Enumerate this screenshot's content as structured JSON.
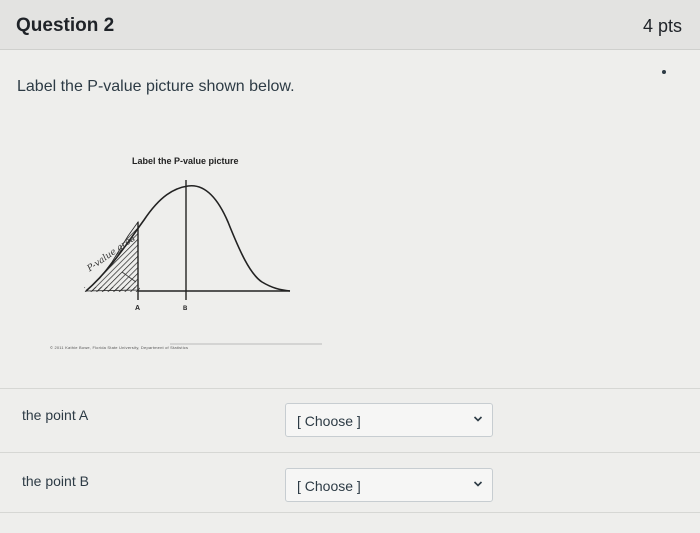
{
  "question": {
    "title": "Question 2",
    "points": "4 pts",
    "prompt": "Label the P-value picture shown below."
  },
  "figure": {
    "title": "Label the P-value picture",
    "point_a_label": "A",
    "point_b_label": "B",
    "handwritten_note": "P-value area",
    "credit": "© 2011 Kathie Bowe, Florida State University, Department of Statistics"
  },
  "rows": [
    {
      "label": "the point A",
      "select_value": "[ Choose ]"
    },
    {
      "label": "the point B",
      "select_value": "[ Choose ]"
    }
  ]
}
